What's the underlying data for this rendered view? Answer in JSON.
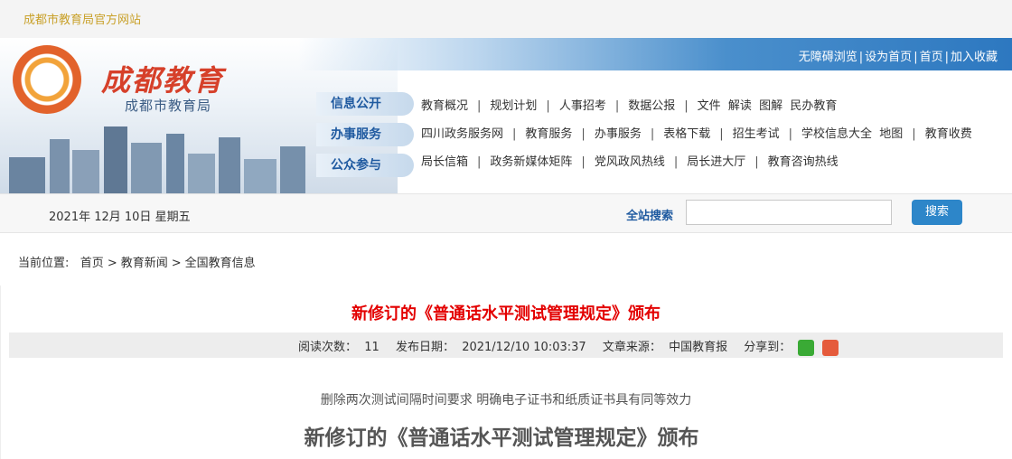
{
  "topbar": {
    "site_name": "成都市教育局官方网站"
  },
  "header": {
    "logo_title": "成都教育",
    "logo_subtitle": "成都市教育局",
    "top_links": [
      "无障碍浏览",
      "设为首页",
      "首页",
      "加入收藏"
    ],
    "tabs": [
      "信息公开",
      "办事服务",
      "公众参与"
    ],
    "nav_rows": [
      [
        "教育概况",
        "规划计划",
        "人事招考",
        "数据公报",
        "文件  解读  图解  民办教育"
      ],
      [
        "四川政务服务网",
        "教育服务",
        "办事服务",
        "表格下载",
        "招生考试",
        "学校信息大全  地图",
        "教育收费"
      ],
      [
        "局长信箱",
        "政务新媒体矩阵",
        "党风政风热线",
        "局长进大厅",
        "教育咨询热线"
      ]
    ]
  },
  "searchbar": {
    "date": "2021年 12月 10日 星期五",
    "label": "全站搜索",
    "input_value": "",
    "button_label": "搜索"
  },
  "breadcrumb": {
    "prefix": "当前位置:",
    "items": [
      "首页",
      "教育新闻",
      "全国教育信息"
    ]
  },
  "article": {
    "title": "新修订的《普通话水平测试管理规定》颁布",
    "meta": {
      "views": "阅读次数：  11",
      "date": "发布日期：  2021/12/10 10:03:37",
      "source": "文章来源：  中国教育报",
      "share": "分享到："
    },
    "subtitle": "删除两次测试间隔时间要求 明确电子证书和纸质证书具有同等效力",
    "heading": "新修订的《普通话水平测试管理规定》颁布"
  },
  "colors": {
    "accent": "#2d86c9",
    "title_red": "#e30000",
    "site_gold": "#c9a12a"
  }
}
